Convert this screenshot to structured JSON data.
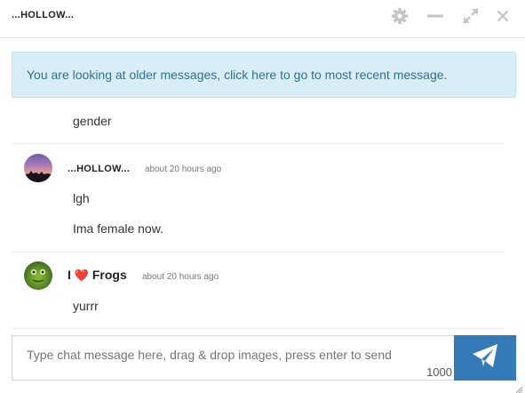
{
  "header": {
    "title": "...HOLLOW...",
    "icons": [
      "gear-icon",
      "minimize-icon",
      "expand-icon",
      "close-icon"
    ]
  },
  "notice": {
    "text": "You are looking at older messages, click here to go to most recent message."
  },
  "messages": [
    {
      "text": "gender"
    },
    {
      "author": "...HOLLOW...",
      "time": "about 20 hours ago",
      "lines": [
        "lgh",
        "Ima female now."
      ]
    },
    {
      "author_prefix": "I",
      "author_suffix": "Frogs",
      "author_emoji": "heart",
      "time": "about 20 hours ago",
      "lines": [
        "yurrr"
      ]
    }
  ],
  "composer": {
    "placeholder": "Type chat message here, drag & drop images, press enter to send",
    "counter": "1000",
    "send_icon": "paper-plane-icon"
  },
  "colors": {
    "accent": "#337ab7",
    "notice_bg": "#d9edf7",
    "notice_text": "#31708f",
    "heart": "#e0245e"
  }
}
